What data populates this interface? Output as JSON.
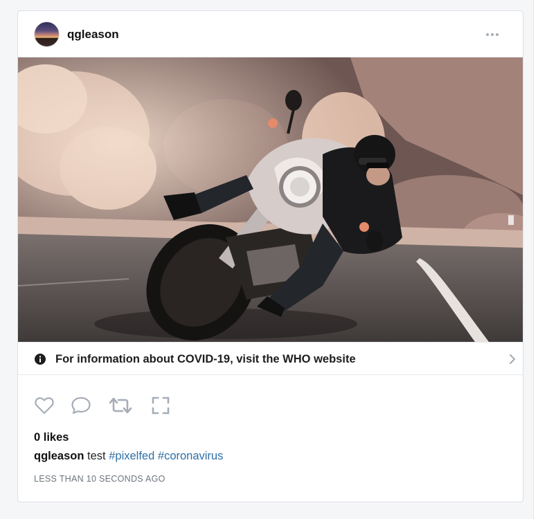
{
  "post": {
    "username": "qgleason",
    "photo_alt": "",
    "covid_banner": "For information about COVID-19, visit the WHO website",
    "likes": "0 likes",
    "caption": {
      "username": "qgleason",
      "text": "test",
      "hashtags": [
        "#pixelfed",
        "#coronavirus"
      ]
    },
    "timestamp": "LESS THAN 10 SECONDS AGO"
  },
  "icons": {
    "more": "more-horizontal-icon",
    "info": "info-circle-icon",
    "chevron": "chevron-right-icon",
    "like": "heart-icon",
    "comment": "comment-icon",
    "share": "repost-icon",
    "expand": "expand-icon"
  },
  "colors": {
    "icon_gray": "#a6adb7",
    "hashtag": "#2f6fa7",
    "muted": "#6c757d"
  }
}
